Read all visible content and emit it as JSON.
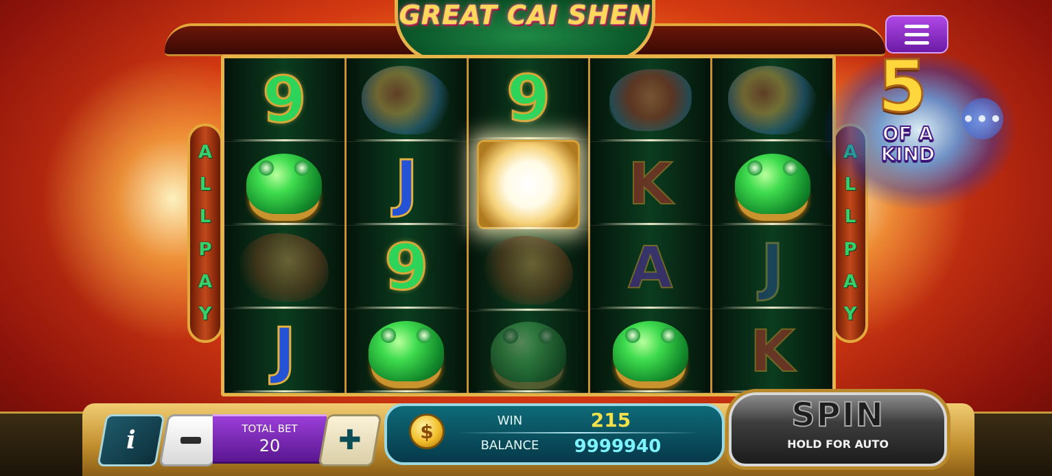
{
  "game": {
    "title": "GREAT CAI SHEN",
    "side_banner_left": [
      "A",
      "L",
      "L",
      "P",
      "A",
      "Y"
    ],
    "side_banner_right": [
      "A",
      "L",
      "L",
      "P",
      "A",
      "Y"
    ]
  },
  "menu": {
    "icon": "hamburger-menu-icon"
  },
  "win_overlay": {
    "count": "5",
    "text_line1": "OF A",
    "text_line2": "KIND",
    "bubble": "•••"
  },
  "reels": [
    [
      {
        "symbol": "9",
        "kind": "nine"
      },
      {
        "symbol": "frog",
        "kind": "frog"
      },
      {
        "symbol": "dragon",
        "kind": "dragon",
        "dim": true
      },
      {
        "symbol": "J",
        "kind": "jack"
      }
    ],
    [
      {
        "symbol": "dragon",
        "kind": "dragon-colorful",
        "dim": true
      },
      {
        "symbol": "J",
        "kind": "jack"
      },
      {
        "symbol": "9",
        "kind": "nine"
      },
      {
        "symbol": "frog",
        "kind": "frog"
      }
    ],
    [
      {
        "symbol": "9",
        "kind": "nine"
      },
      {
        "symbol": "coin",
        "kind": "coin-burst"
      },
      {
        "symbol": "dragon",
        "kind": "dragon",
        "dim": true
      },
      {
        "symbol": "frog",
        "kind": "frog",
        "dim": true
      }
    ],
    [
      {
        "symbol": "koi",
        "kind": "koi",
        "dim": true
      },
      {
        "symbol": "K",
        "kind": "king"
      },
      {
        "symbol": "A",
        "kind": "ace"
      },
      {
        "symbol": "frog",
        "kind": "frog"
      }
    ],
    [
      {
        "symbol": "dragon",
        "kind": "dragon-colorful",
        "dim": true
      },
      {
        "symbol": "frog",
        "kind": "frog"
      },
      {
        "symbol": "J",
        "kind": "jack",
        "dim": true
      },
      {
        "symbol": "K",
        "kind": "king"
      }
    ]
  ],
  "controls": {
    "info_label": "i",
    "minus_icon": "minus-icon",
    "total_bet_label": "TOTAL BET",
    "total_bet_value": "20",
    "plus_label": "✚",
    "coin_symbol": "$",
    "win_label": "WIN",
    "win_value": "215",
    "balance_label": "BALANCE",
    "balance_value": "9999940",
    "spin_label": "SPIN",
    "spin_sub_label": "HOLD FOR AUTO"
  },
  "colors": {
    "gold": "#e7b44a",
    "win_value": "#f3e04a",
    "balance_value": "#7df3ff",
    "total_bet_bg": "#7a2bb5",
    "panel_teal": "#0e6a78"
  }
}
